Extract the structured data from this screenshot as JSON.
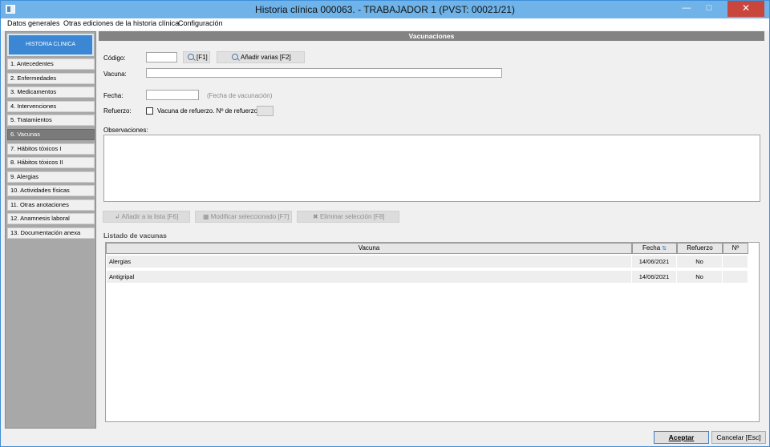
{
  "window": {
    "title": "Historia clínica 000063.   - TRABAJADOR 1   (PVST: 00021/21)",
    "minimize": "—",
    "maximize": "□",
    "close": "✕"
  },
  "menu": [
    "Datos generales",
    "Otras ediciones de la historia clínica",
    "Configuración"
  ],
  "sidebar": {
    "header": "HISTORIA CLINICA",
    "items": [
      {
        "label": "1. Antecedentes"
      },
      {
        "label": "2. Enfermedades"
      },
      {
        "label": "3. Medicamentos"
      },
      {
        "label": "4. Intervenciones"
      },
      {
        "label": "5. Tratamientos"
      },
      {
        "label": "6. Vacunas"
      },
      {
        "label": "7. Hábitos tóxicos I"
      },
      {
        "label": "8. Hábitos tóxicos II"
      },
      {
        "label": "9. Alergias"
      },
      {
        "label": "10. Actividades físicas"
      },
      {
        "label": "11. Otras anotaciones"
      },
      {
        "label": "12. Anamnesis laboral"
      },
      {
        "label": "13. Documentación anexa"
      }
    ],
    "active_index": 5
  },
  "section": {
    "title": "Vacunaciones"
  },
  "form": {
    "codigo_label": "Código:",
    "codigo_value": "",
    "search_button": "[F1]",
    "add_several_button": "Añadir varias  [F2]",
    "vacuna_label": "Vacuna:",
    "vacuna_value": "",
    "fecha_label": "Fecha:",
    "fecha_value": "",
    "fecha_hint": "(Fecha de vacunación)",
    "refuerzo_label": "Refuerzo:",
    "refuerzo_checkbox_label": "Vacuna de refuerzo. Nº de refuerzo:",
    "refuerzo_checked": false,
    "refuerzo_number": "",
    "observaciones_label": "Observaciones:",
    "observaciones_value": ""
  },
  "actions": {
    "add": "Añadir a la lista  [F6]",
    "modify": "Modificar seleccionado  [F7]",
    "delete": "Eliminar selección  [F8]"
  },
  "list": {
    "title": "Listado de vacunas",
    "columns": [
      "Vacuna",
      "Fecha",
      "Refuerzo",
      "Nº"
    ],
    "rows": [
      {
        "vacuna": "Alergias",
        "fecha": "14/06/2021",
        "refuerzo": "No",
        "numero": ""
      },
      {
        "vacuna": "Antigripal",
        "fecha": "14/06/2021",
        "refuerzo": "No",
        "numero": ""
      }
    ]
  },
  "footer": {
    "accept": "Aceptar",
    "cancel": "Cancelar [Esc]"
  },
  "colors": {
    "titlebar": "#6fb3e8",
    "sidebar_header": "#3b87d3",
    "active_item": "#7a7a7a",
    "close_button": "#c9463d"
  }
}
